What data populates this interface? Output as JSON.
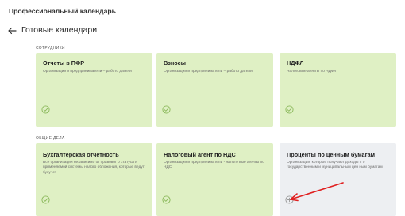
{
  "app": {
    "title": "Профессиональный календарь"
  },
  "header": {
    "title": "Готовые календари"
  },
  "sections": [
    {
      "label": "СОТРУДНИКИ",
      "cards": [
        {
          "title": "Отчеты в ПФР",
          "description": "Организации и предприниматели – работо датели",
          "status": "check-icon",
          "selected": true
        },
        {
          "title": "Взносы",
          "description": "Организации и предприниматели – работо датели",
          "status": "check-icon",
          "selected": true
        },
        {
          "title": "НДФЛ",
          "description": "Налоговые агенты по НДФЛ",
          "status": "check-icon",
          "selected": true
        }
      ]
    },
    {
      "label": "ОБЩИЕ ДЕЛА",
      "cards": [
        {
          "title": "Бухгалтерская отчетность",
          "description": "Все организации независимо от правовог о статуса и применяемой системы налого обложения, которые ведут бухучет",
          "status": "check-icon",
          "selected": true
        },
        {
          "title": "Налоговый агент по НДС",
          "description": "Организации и предприниматели - налого вые агенты по НДС",
          "status": "check-icon",
          "selected": true
        },
        {
          "title": "Проценты по ценным бумагам",
          "description": "Организации, которые получают доходы п о государственным и муниципальным цен ным бумагам",
          "status": "add-icon",
          "selected": false
        }
      ]
    }
  ],
  "colors": {
    "card_selected": "#dff0c4",
    "card_unselected": "#edeff2",
    "check": "#8ab85a",
    "add": "#9a9a9a",
    "annotation_arrow": "#e02020"
  }
}
